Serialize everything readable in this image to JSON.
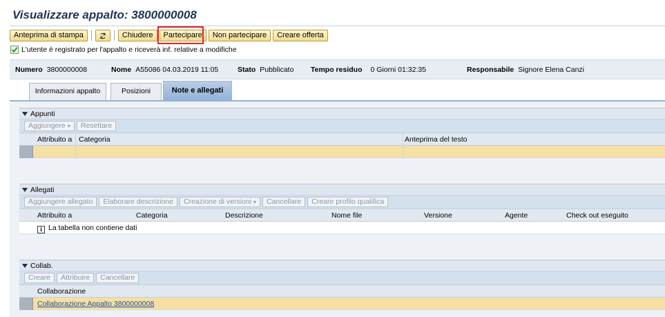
{
  "page": {
    "title": "Visualizzare appalto: 3800000008"
  },
  "toolbar": {
    "print_preview": "Anteprima di stampa",
    "refresh_icon": "refresh-icon",
    "close": "Chiudere",
    "participate": "Partecipare",
    "not_participate": "Non partecipare",
    "create_offer": "Creare offerta"
  },
  "message": {
    "text": "L'utente è registrato per l'appalto e riceverà inf. relative a modifiche",
    "icon": "check-icon"
  },
  "header": {
    "numero_label": "Numero",
    "numero_value": "3800000008",
    "nome_label": "Nome",
    "nome_value": "A55086 04.03.2019 11:05",
    "stato_label": "Stato",
    "stato_value": "Pubblicato",
    "tempo_label": "Tempo residuo",
    "tempo_value": "0 Giorni 01:32:35",
    "resp_label": "Responsabile",
    "resp_value": "Signore Elena Canzi"
  },
  "tabs": [
    {
      "label": "Informazioni appalto"
    },
    {
      "label": "Posizioni"
    },
    {
      "label": "Note e allegati"
    }
  ],
  "appunti": {
    "title": "Appunti",
    "buttons": {
      "add": "Aggiungere",
      "reset": "Resettare"
    },
    "columns": [
      "Attribuito a",
      "Categoria",
      "Anteprima del testo"
    ]
  },
  "allegati": {
    "title": "Allegati",
    "buttons": {
      "add_attachment": "Aggiungere allegato",
      "edit_description": "Elaborare descrizione",
      "create_versions": "Creazione di versioni",
      "delete": "Cancellare",
      "create_profile": "Creare profilo qualifica"
    },
    "columns": [
      "Attribuito a",
      "Categoria",
      "Descrizione",
      "Nome file",
      "Versione",
      "Agente",
      "Check out eseguito"
    ],
    "empty_text": "La tabella non contiene dati"
  },
  "collab": {
    "title": "Collab.",
    "buttons": {
      "create": "Creare",
      "assign": "Attribuire",
      "delete": "Cancellare"
    },
    "column": "Collaborazione",
    "row_link": "Collaborazione Appalto 3800000008"
  },
  "colors": {
    "accent_blue": "#93b3d8",
    "button_yellow": "#f3dc8e",
    "row_yellow": "#f5dfa3",
    "highlight_red": "#e0222b"
  }
}
